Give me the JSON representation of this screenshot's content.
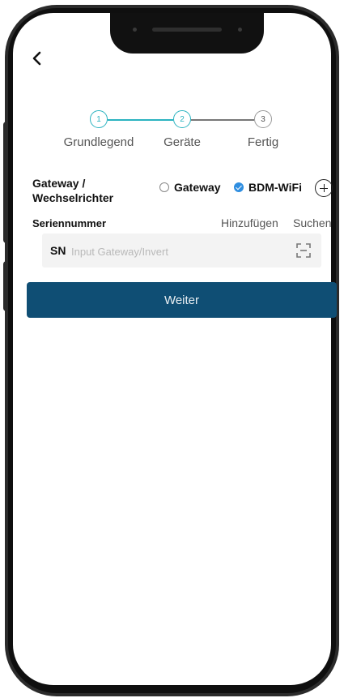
{
  "navigation": {
    "back_icon": "chevron-left-icon"
  },
  "stepper": {
    "active_color": "#2bb3c0",
    "inactive_color": "#999999",
    "steps": [
      {
        "number": "1",
        "label": "Grundlegend",
        "state": "done"
      },
      {
        "number": "2",
        "label": "Geräte",
        "state": "active"
      },
      {
        "number": "3",
        "label": "Fertig",
        "state": "pending"
      }
    ]
  },
  "device_type": {
    "label": "Gateway /\nWechselrichter",
    "options": [
      {
        "label": "Gateway",
        "selected": false
      },
      {
        "label": "BDM-WiFi",
        "selected": true
      }
    ],
    "add_icon": "plus-circle-icon"
  },
  "serial": {
    "title": "Seriennummer",
    "add_link": "Hinzufügen",
    "search_link": "Suchen",
    "prefix": "SN",
    "placeholder": "Input Gateway/Invert",
    "value": "",
    "scan_icon": "scan-icon"
  },
  "actions": {
    "next_label": "Weiter",
    "next_color": "#0f4e74"
  }
}
